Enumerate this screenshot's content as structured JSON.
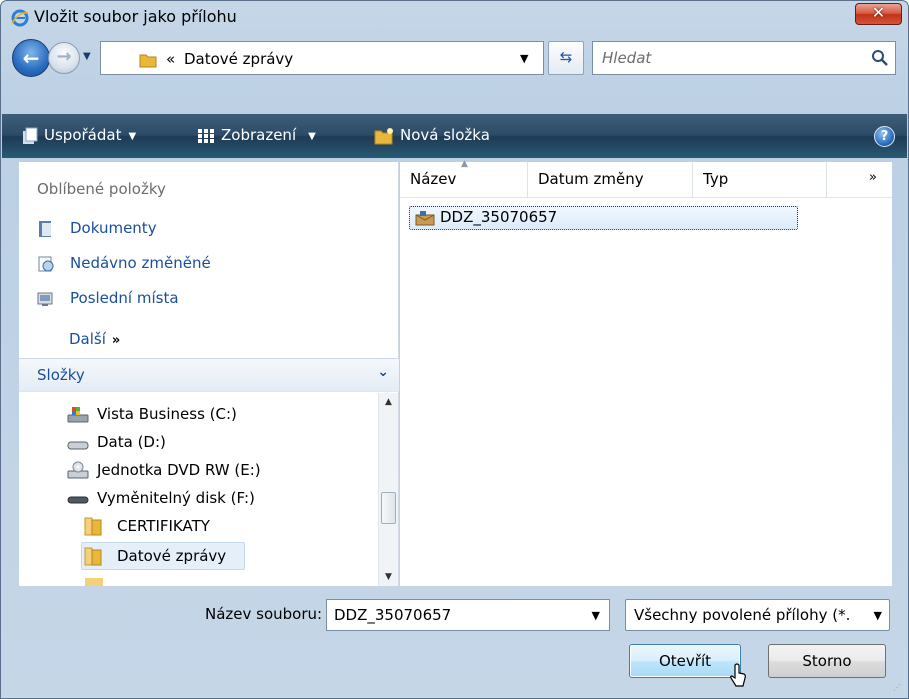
{
  "window": {
    "title": "Vložit soubor jako přílohu",
    "close_glyph": "✕"
  },
  "address": {
    "back_glyph": "←",
    "forward_glyph": "→",
    "chevrons": "«",
    "path": "Datové zprávy",
    "search_placeholder": "Hledat"
  },
  "toolbar": {
    "organize_label": "Uspořádat",
    "views_label": "Zobrazení",
    "new_folder_label": "Nová složka",
    "help_glyph": "?"
  },
  "favorites": {
    "header": "Oblíbené položky",
    "items": [
      {
        "label": "Dokumenty",
        "icon": "documents-icon"
      },
      {
        "label": "Nedávno změněné",
        "icon": "recent-icon"
      },
      {
        "label": "Poslední místa",
        "icon": "places-icon"
      }
    ],
    "more_label": "Další",
    "more_glyph": "»"
  },
  "folders": {
    "header": "Složky",
    "items": [
      {
        "label": "Vista Business (C:)",
        "icon": "system-drive-icon"
      },
      {
        "label": "Data (D:)",
        "icon": "hard-drive-icon"
      },
      {
        "label": "Jednotka DVD RW (E:)",
        "icon": "dvd-drive-icon"
      },
      {
        "label": "Vyměnitelný disk (F:)",
        "icon": "removable-drive-icon"
      },
      {
        "label": "CERTIFIKATY",
        "icon": "folder-icon"
      },
      {
        "label": "Datové zprávy",
        "icon": "folder-icon",
        "selected": true
      }
    ]
  },
  "file_list": {
    "columns": [
      "Název",
      "Datum změny",
      "Typ"
    ],
    "more_glyph": "»",
    "files": [
      {
        "name": "DDZ_35070657",
        "icon": "data-message-icon"
      }
    ]
  },
  "footer": {
    "filename_label": "Název souboru:",
    "filename_value": "DDZ_35070657",
    "filter_value": "Všechny povolené přílohy (*.",
    "open_label": "Otevřít",
    "cancel_label": "Storno"
  },
  "colors": {
    "toolbar": "#2c4b66",
    "link": "#1a4e9f",
    "close_button": "#c23218",
    "selection": "#dcebfc"
  }
}
